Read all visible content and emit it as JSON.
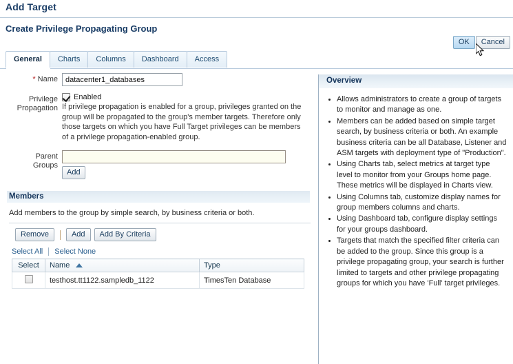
{
  "app": {
    "title": "Add Target"
  },
  "heading": "Create Privilege Propagating Group",
  "actions": {
    "ok_label": "OK",
    "cancel_label": "Cancel"
  },
  "tabs": [
    {
      "label": "General",
      "active": true
    },
    {
      "label": "Charts",
      "active": false
    },
    {
      "label": "Columns",
      "active": false
    },
    {
      "label": "Dashboard",
      "active": false
    },
    {
      "label": "Access",
      "active": false
    }
  ],
  "form": {
    "name_label": "Name",
    "name_required_marker": "*",
    "name_value": "datacenter1_databases",
    "name_placeholder": "",
    "privilege_propagation_label_line1": "Privilege",
    "privilege_propagation_label_line2": "Propagation",
    "enabled_label": "Enabled",
    "enabled_checked": true,
    "privilege_help": "If privilege propagation is enabled for a group, privileges granted on the group will be propagated to the group's member targets. Therefore only those targets on which you have Full Target privileges can be members of a privilege propagation-enabled group.",
    "parent_groups_label_line1": "Parent",
    "parent_groups_label_line2": "Groups",
    "parent_groups_value": "",
    "parent_groups_placeholder": "",
    "parent_add_label": "Add"
  },
  "members": {
    "section_title": "Members",
    "subtitle": "Add members to the group by simple search, by business criteria or both.",
    "toolbar": {
      "remove_label": "Remove",
      "add_label": "Add",
      "add_by_criteria_label": "Add By Criteria"
    },
    "select_all_label": "Select All",
    "select_none_label": "Select None",
    "table": {
      "columns": [
        "Select",
        "Name",
        "Type"
      ],
      "sort_column": "Name",
      "sort_direction": "ascending",
      "rows": [
        {
          "selected": false,
          "name": "testhost.tt1122.sampledb_1122",
          "type": "TimesTen Database"
        }
      ]
    }
  },
  "overview": {
    "title": "Overview",
    "items": [
      "Allows administrators to create a group of targets to monitor and manage as one.",
      "Members can be added based on simple target search, by business criteria or both. An example business criteria can be all Database, Listener and ASM targets with deployment type of \"Production\".",
      "Using Charts tab, select metrics at target type level to monitor from your Groups home page. These metrics will be displayed in Charts view.",
      "Using Columns tab, customize display names for group members columns and charts.",
      "Using Dashboard tab, configure display settings for your groups dashboard.",
      "Targets that match the specified filter criteria can be added to the group. Since this group is a privilege propagating group, your search is further limited to targets and other privilege propagating groups for which you have 'Full' target privileges."
    ]
  },
  "colors": {
    "heading_blue": "#1a3d66",
    "panel_header_blue": "#16365c",
    "link_blue": "#2a5f8f",
    "required_red": "#b21a1a",
    "hover_button_blue": "#c8e2f6"
  }
}
